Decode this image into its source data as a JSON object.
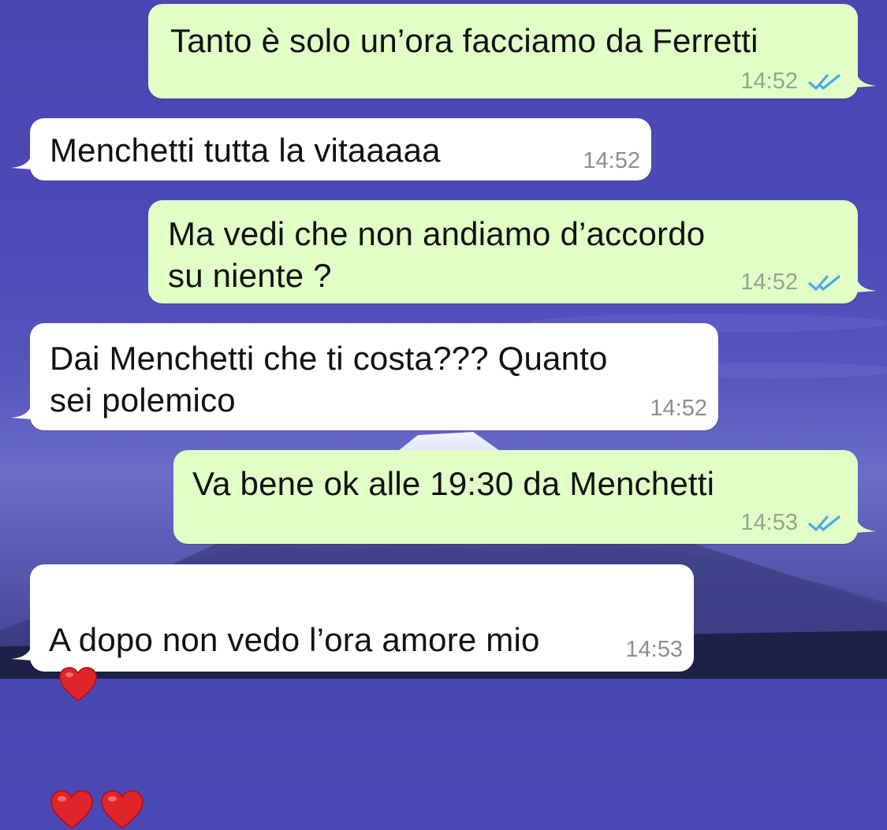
{
  "messages": [
    {
      "direction": "out",
      "text": "Tanto è solo un’ora facciamo da Ferretti",
      "time": "14:52",
      "status": "read"
    },
    {
      "direction": "in",
      "text": "Menchetti tutta la vitaaaaa",
      "time": "14:52"
    },
    {
      "direction": "out",
      "text": "Ma vedi che non andiamo d’accordo\nsu niente ?",
      "time": "14:52",
      "status": "read"
    },
    {
      "direction": "in",
      "text": "Dai Menchetti che ti costa??? Quanto\nsei polemico",
      "time": "14:52"
    },
    {
      "direction": "out",
      "text": "Va bene ok alle 19:30 da Menchetti",
      "time": "14:53",
      "status": "read"
    },
    {
      "direction": "in",
      "text": "A dopo non vedo l’ora amore mio",
      "emoji": [
        "heart-icon",
        "heart-icon",
        "heart-icon"
      ],
      "time": "14:53"
    }
  ],
  "colors": {
    "outgoing_bubble": "#e1fec6",
    "incoming_bubble": "#ffffff",
    "read_ticks": "#4fa8e8",
    "wallpaper": "#4a46b2"
  }
}
